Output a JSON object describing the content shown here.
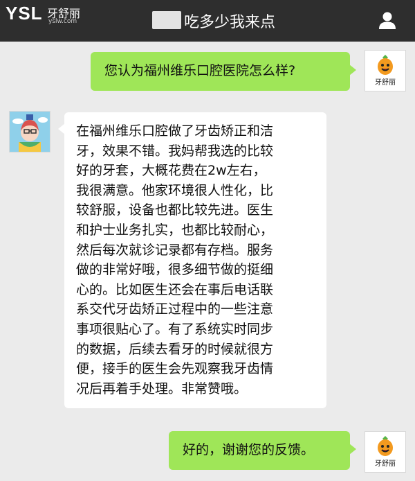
{
  "header": {
    "logo_ysl": "YSL",
    "logo_name": "牙舒丽",
    "logo_url": "yslw.com",
    "title": "吃多少我来点",
    "profile_icon": "person-icon"
  },
  "brand_avatar": {
    "label": "牙舒丽",
    "icon": "carrot-mascot-icon"
  },
  "messages": [
    {
      "sender": "self",
      "text": "您认为福州维乐口腔医院怎么样?"
    },
    {
      "sender": "other",
      "avatar_icon": "cartoon-girl-avatar-icon",
      "lines": [
        "在福州维乐口腔做了牙齿矫正和洁",
        "牙，效果不错。我妈帮我选的比较",
        "好的牙套，大概花费在2w左右，",
        "我很满意。他家环境很人性化，比",
        "较舒服，设备也都比较先进。医生",
        "和护士业务扎实，也都比较耐心，",
        "然后每次就诊记录都有存档。服务",
        "做的非常好哦，很多细节做的挺细",
        "心的。比如医生还会在事后电话联",
        "系交代牙齿矫正过程中的一些注意",
        "事项很贴心了。有了系统实时同步",
        "的数据，后续去看牙的时候就很方",
        "便，接手的医生会先观察我牙齿情",
        "况后再着手处理。非常赞哦。"
      ]
    },
    {
      "sender": "self",
      "text": "好的，谢谢您的反馈。"
    }
  ],
  "colors": {
    "header_bg": "#2e2e2e",
    "chat_bg": "#ebebeb",
    "self_bubble": "#9fe658",
    "other_bubble": "#ffffff"
  }
}
